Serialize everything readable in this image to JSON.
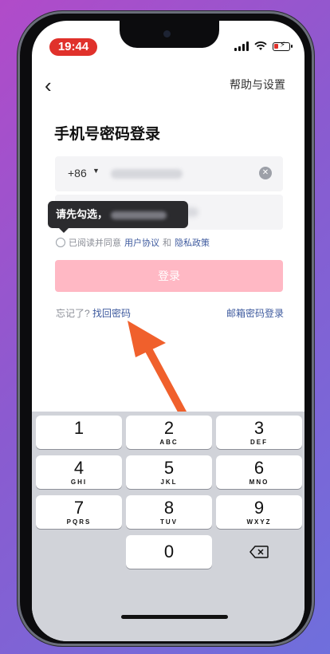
{
  "status_bar": {
    "time": "19:44"
  },
  "nav": {
    "back_label": "‹",
    "help_label": "帮助与设置"
  },
  "page": {
    "title": "手机号密码登录"
  },
  "phone_field": {
    "country_code": "+86"
  },
  "tooltip": {
    "text": "请先勾选"
  },
  "agreement": {
    "prefix": "已阅读并同意",
    "user_agreement": "用户协议",
    "and": "和",
    "privacy_policy": "隐私政策"
  },
  "login_button": {
    "label": "登录"
  },
  "forgot": {
    "prefix": "忘记了?",
    "link": "找回密码"
  },
  "email_login": {
    "label": "邮箱密码登录"
  },
  "keyboard": {
    "keys": [
      {
        "n": "1",
        "l": ""
      },
      {
        "n": "2",
        "l": "ABC"
      },
      {
        "n": "3",
        "l": "DEF"
      },
      {
        "n": "4",
        "l": "GHI"
      },
      {
        "n": "5",
        "l": "JKL"
      },
      {
        "n": "6",
        "l": "MNO"
      },
      {
        "n": "7",
        "l": "PQRS"
      },
      {
        "n": "8",
        "l": "TUV"
      },
      {
        "n": "9",
        "l": "WXYZ"
      },
      {
        "n": "0",
        "l": ""
      }
    ]
  },
  "colors": {
    "accent_link": "#3e5a9e",
    "login_disabled": "#ffb8c4",
    "arrow": "#f0602c",
    "time_pill": "#e0312b"
  }
}
